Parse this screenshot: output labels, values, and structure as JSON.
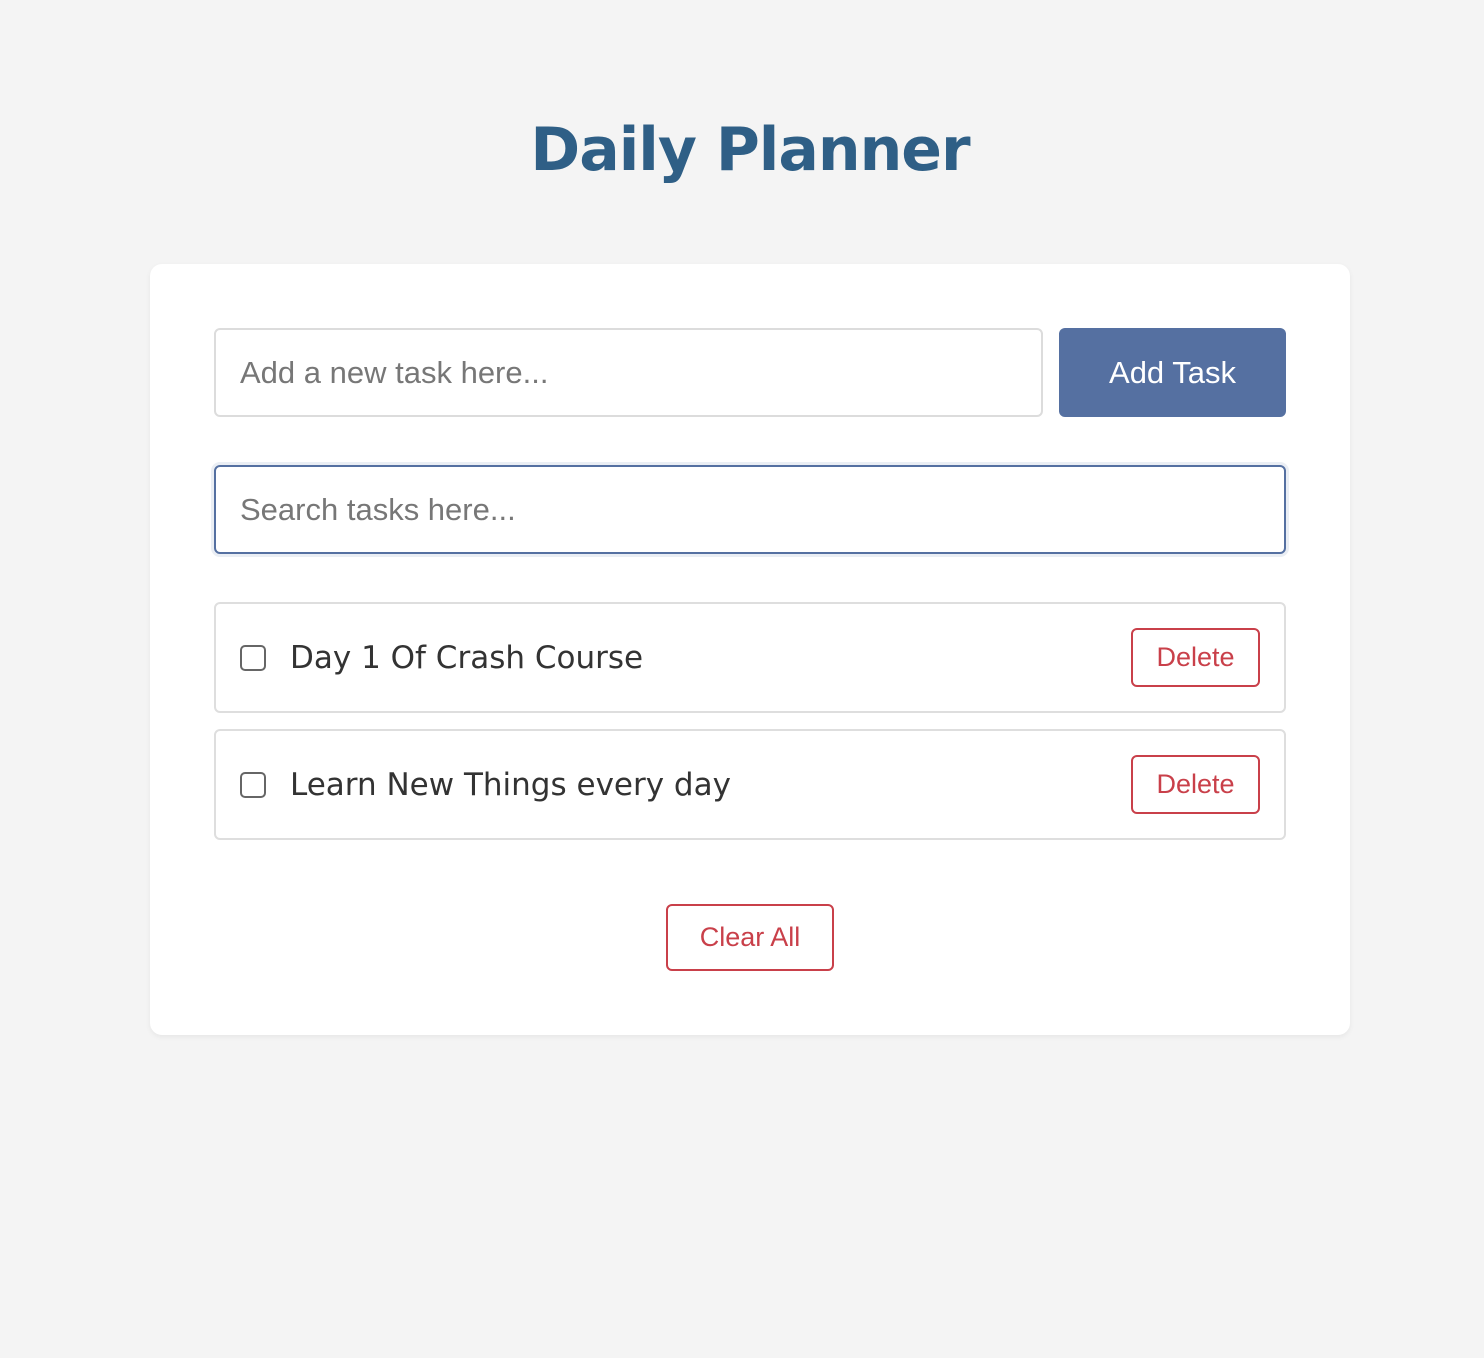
{
  "header": {
    "title": "Daily Planner"
  },
  "add_task": {
    "input_value": "",
    "placeholder": "Add a new task here...",
    "button_label": "Add Task"
  },
  "search": {
    "input_value": "",
    "placeholder": "Search tasks here..."
  },
  "tasks": [
    {
      "text": "Day 1 Of Crash Course",
      "checked": false,
      "delete_label": "Delete"
    },
    {
      "text": "Learn New Things every day",
      "checked": false,
      "delete_label": "Delete"
    }
  ],
  "footer": {
    "clear_label": "Clear All"
  },
  "colors": {
    "title": "#2f5f86",
    "primary": "#5570a1",
    "danger": "#c9404a",
    "background": "#f4f4f4",
    "card": "#ffffff"
  }
}
